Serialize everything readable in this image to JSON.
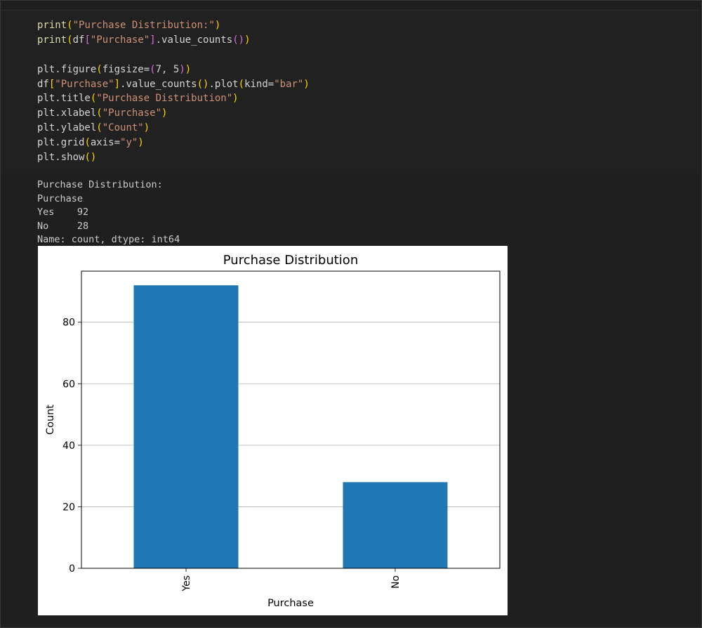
{
  "code_lines": [
    [
      {
        "t": "print",
        "c": "fn"
      },
      {
        "t": "(",
        "c": "p1"
      },
      {
        "t": "\"Purchase Distribution:\"",
        "c": "str"
      },
      {
        "t": ")",
        "c": "p1"
      }
    ],
    [
      {
        "t": "print",
        "c": "fn"
      },
      {
        "t": "(",
        "c": "p1"
      },
      {
        "t": "df",
        "c": "id"
      },
      {
        "t": "[",
        "c": "p2"
      },
      {
        "t": "\"Purchase\"",
        "c": "str"
      },
      {
        "t": "]",
        "c": "p2"
      },
      {
        "t": ".value_counts",
        "c": "id"
      },
      {
        "t": "()",
        "c": "p2"
      },
      {
        "t": ")",
        "c": "p1"
      }
    ],
    [],
    [
      {
        "t": "plt.figure",
        "c": "id"
      },
      {
        "t": "(",
        "c": "p1"
      },
      {
        "t": "figsize=",
        "c": "id"
      },
      {
        "t": "(",
        "c": "p2"
      },
      {
        "t": "7, 5",
        "c": "id"
      },
      {
        "t": ")",
        "c": "p2"
      },
      {
        "t": ")",
        "c": "p1"
      }
    ],
    [
      {
        "t": "df",
        "c": "id"
      },
      {
        "t": "[",
        "c": "p1"
      },
      {
        "t": "\"Purchase\"",
        "c": "str"
      },
      {
        "t": "]",
        "c": "p1"
      },
      {
        "t": ".value_counts",
        "c": "id"
      },
      {
        "t": "()",
        "c": "p1"
      },
      {
        "t": ".plot",
        "c": "id"
      },
      {
        "t": "(",
        "c": "p1"
      },
      {
        "t": "kind=",
        "c": "id"
      },
      {
        "t": "\"bar\"",
        "c": "str"
      },
      {
        "t": ")",
        "c": "p1"
      }
    ],
    [
      {
        "t": "plt.title",
        "c": "id"
      },
      {
        "t": "(",
        "c": "p1"
      },
      {
        "t": "\"Purchase Distribution\"",
        "c": "str"
      },
      {
        "t": ")",
        "c": "p1"
      }
    ],
    [
      {
        "t": "plt.xlabel",
        "c": "id"
      },
      {
        "t": "(",
        "c": "p1"
      },
      {
        "t": "\"Purchase\"",
        "c": "str"
      },
      {
        "t": ")",
        "c": "p1"
      }
    ],
    [
      {
        "t": "plt.ylabel",
        "c": "id"
      },
      {
        "t": "(",
        "c": "p1"
      },
      {
        "t": "\"Count\"",
        "c": "str"
      },
      {
        "t": ")",
        "c": "p1"
      }
    ],
    [
      {
        "t": "plt.grid",
        "c": "id"
      },
      {
        "t": "(",
        "c": "p1"
      },
      {
        "t": "axis=",
        "c": "id"
      },
      {
        "t": "\"y\"",
        "c": "str"
      },
      {
        "t": ")",
        "c": "p1"
      }
    ],
    [
      {
        "t": "plt.show",
        "c": "id"
      },
      {
        "t": "()",
        "c": "p1"
      }
    ]
  ],
  "stdout_lines": [
    "Purchase Distribution:",
    "Purchase",
    "Yes    92",
    "No     28",
    "Name: count, dtype: int64"
  ],
  "colors": {
    "bar": "#1f77b4",
    "grid": "#b0b0b0",
    "fn": "#dcdcaa",
    "str": "#ce9178",
    "p1": "#ffd700",
    "p2": "#da70d6"
  },
  "chart_data": {
    "type": "bar",
    "title": "Purchase Distribution",
    "xlabel": "Purchase",
    "ylabel": "Count",
    "categories": [
      "Yes",
      "No"
    ],
    "values": [
      92,
      28
    ],
    "ylim": [
      0,
      96.6
    ],
    "yticks": [
      0,
      20,
      40,
      60,
      80
    ],
    "grid": "y"
  }
}
